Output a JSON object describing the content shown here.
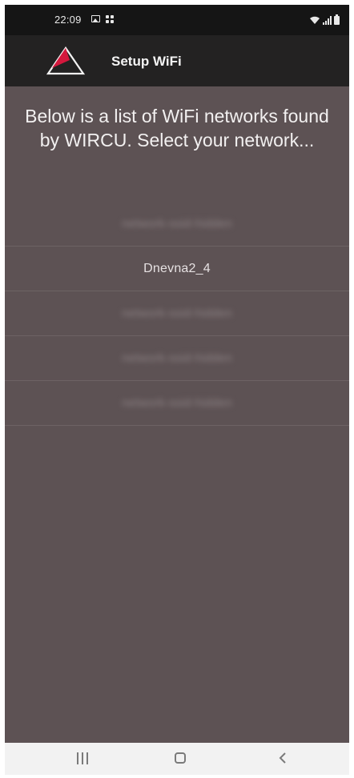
{
  "status_bar": {
    "time": "22:09",
    "icons": [
      "gallery-icon",
      "grid-icon",
      "wifi-icon",
      "signal-icon",
      "battery-icon"
    ]
  },
  "app_bar": {
    "title": "Setup WiFi",
    "logo": "wircu-logo-icon",
    "logo_accent_color": "#d4183d"
  },
  "intro_text": "Below is a list of WiFi networks found by WIRCU. Select your network...",
  "networks": [
    {
      "label": "network-ssid-hidden",
      "blurred": true
    },
    {
      "label": "Dnevna2_4",
      "blurred": false
    },
    {
      "label": "network-ssid-hidden",
      "blurred": true
    },
    {
      "label": "network-ssid-hidden",
      "blurred": true
    },
    {
      "label": "network-ssid-hidden",
      "blurred": true
    }
  ],
  "nav_bar": {
    "icons": [
      "recent-apps-icon",
      "home-icon",
      "back-icon"
    ]
  },
  "colors": {
    "background": "#5d5254",
    "app_bar": "#232222",
    "status_bar": "#151515",
    "nav_bar": "#f2f2f2"
  }
}
